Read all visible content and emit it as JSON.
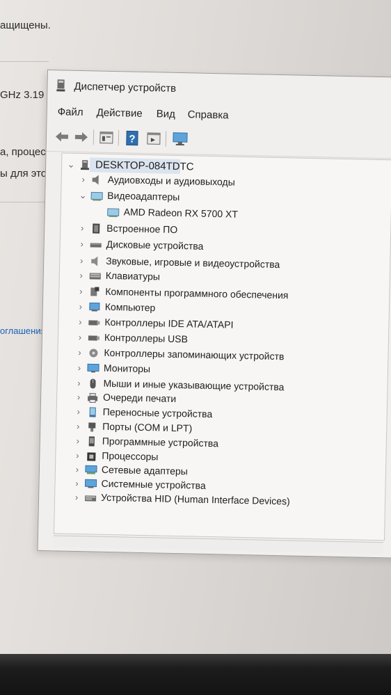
{
  "background": {
    "texts": [
      "ащищены.",
      "GHz  3.19",
      "а, процес",
      "ы для этог"
    ],
    "link_text": "оглашения н"
  },
  "window": {
    "title": "Диспетчер устройств",
    "menu": [
      "Файл",
      "Действие",
      "Вид",
      "Справка"
    ],
    "toolbar": [
      "back-arrow-icon",
      "forward-arrow-icon",
      "properties-icon",
      "help-icon",
      "view-icon",
      "monitor-icon"
    ]
  },
  "tree": {
    "root": {
      "label": "DESKTOP-084TDTC",
      "icon": "computer-icon",
      "expanded": true
    },
    "items": [
      {
        "label": "Аудиовходы и аудиовыходы",
        "icon": "speaker-icon",
        "expanded": false
      },
      {
        "label": "Видеоадаптеры",
        "icon": "display-adapter-icon",
        "expanded": true,
        "children": [
          {
            "label": "AMD Radeon RX 5700 XT",
            "icon": "display-adapter-icon"
          }
        ]
      },
      {
        "label": "Встроенное ПО",
        "icon": "firmware-icon",
        "expanded": false
      },
      {
        "label": "Дисковые устройства",
        "icon": "disk-icon",
        "expanded": false
      },
      {
        "label": "Звуковые, игровые и видеоустройства",
        "icon": "sound-icon",
        "expanded": false
      },
      {
        "label": "Клавиатуры",
        "icon": "keyboard-icon",
        "expanded": false
      },
      {
        "label": "Компоненты программного обеспечения",
        "icon": "software-component-icon",
        "expanded": false
      },
      {
        "label": "Компьютер",
        "icon": "computer-icon",
        "expanded": false
      },
      {
        "label": "Контроллеры IDE ATA/ATAPI",
        "icon": "ide-controller-icon",
        "expanded": false
      },
      {
        "label": "Контроллеры USB",
        "icon": "usb-icon",
        "expanded": false
      },
      {
        "label": "Контроллеры запоминающих устройств",
        "icon": "storage-controller-icon",
        "expanded": false
      },
      {
        "label": "Мониторы",
        "icon": "monitor-icon",
        "expanded": false
      },
      {
        "label": "Мыши и иные указывающие устройства",
        "icon": "mouse-icon",
        "expanded": false
      },
      {
        "label": "Очереди печати",
        "icon": "printer-icon",
        "expanded": false
      },
      {
        "label": "Переносные устройства",
        "icon": "portable-device-icon",
        "expanded": false
      },
      {
        "label": "Порты (COM и LPT)",
        "icon": "port-icon",
        "expanded": false
      },
      {
        "label": "Программные устройства",
        "icon": "software-device-icon",
        "expanded": false
      },
      {
        "label": "Процессоры",
        "icon": "processor-icon",
        "expanded": false
      },
      {
        "label": "Сетевые адаптеры",
        "icon": "network-adapter-icon",
        "expanded": false
      },
      {
        "label": "Системные устройства",
        "icon": "system-device-icon",
        "expanded": false
      },
      {
        "label": "Устройства HID (Human Interface Devices)",
        "icon": "hid-icon",
        "expanded": false
      }
    ]
  },
  "colors": {
    "accent_blue": "#2f6fb0",
    "selection": "#dbe4ee"
  }
}
